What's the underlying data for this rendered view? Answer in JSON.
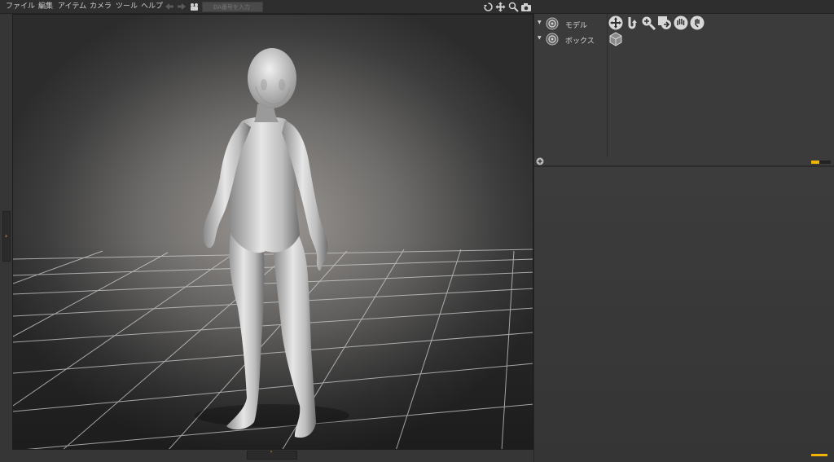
{
  "menubar": {
    "items": [
      "ファイル",
      "編集",
      "アイテム",
      "カメラ",
      "ツール",
      "ヘルプ"
    ],
    "search_placeholder": "DA番号を入力",
    "nav_icons": [
      "back-arrow-icon",
      "forward-arrow-icon",
      "camera-person-icon"
    ],
    "tool_icons": [
      "rotate-icon",
      "move-icon",
      "zoom-icon",
      "camera-icon"
    ]
  },
  "viewport": {
    "icons": [
      "expand-left-icon",
      "expand-up-icon"
    ],
    "left_toggle": "›",
    "bottom_toggle": "ˆ"
  },
  "right_panel": {
    "tree": [
      {
        "label": "モデル",
        "icon": "model-icon"
      },
      {
        "label": "ボックス",
        "icon": "box-icon"
      }
    ],
    "add_icon": "plus-circle-icon",
    "tools": [
      "move-tool-icon",
      "rotate-tool-icon",
      "zoom-tool-icon",
      "undo-tool-icon",
      "hand-tool-icon",
      "grab-tool-icon"
    ],
    "box_icon": "cube-icon",
    "slider_level": 0.4
  },
  "colors": {
    "accent": "#f0b400",
    "background": "#3a3a3a",
    "menubar": "#2e2e2e"
  }
}
